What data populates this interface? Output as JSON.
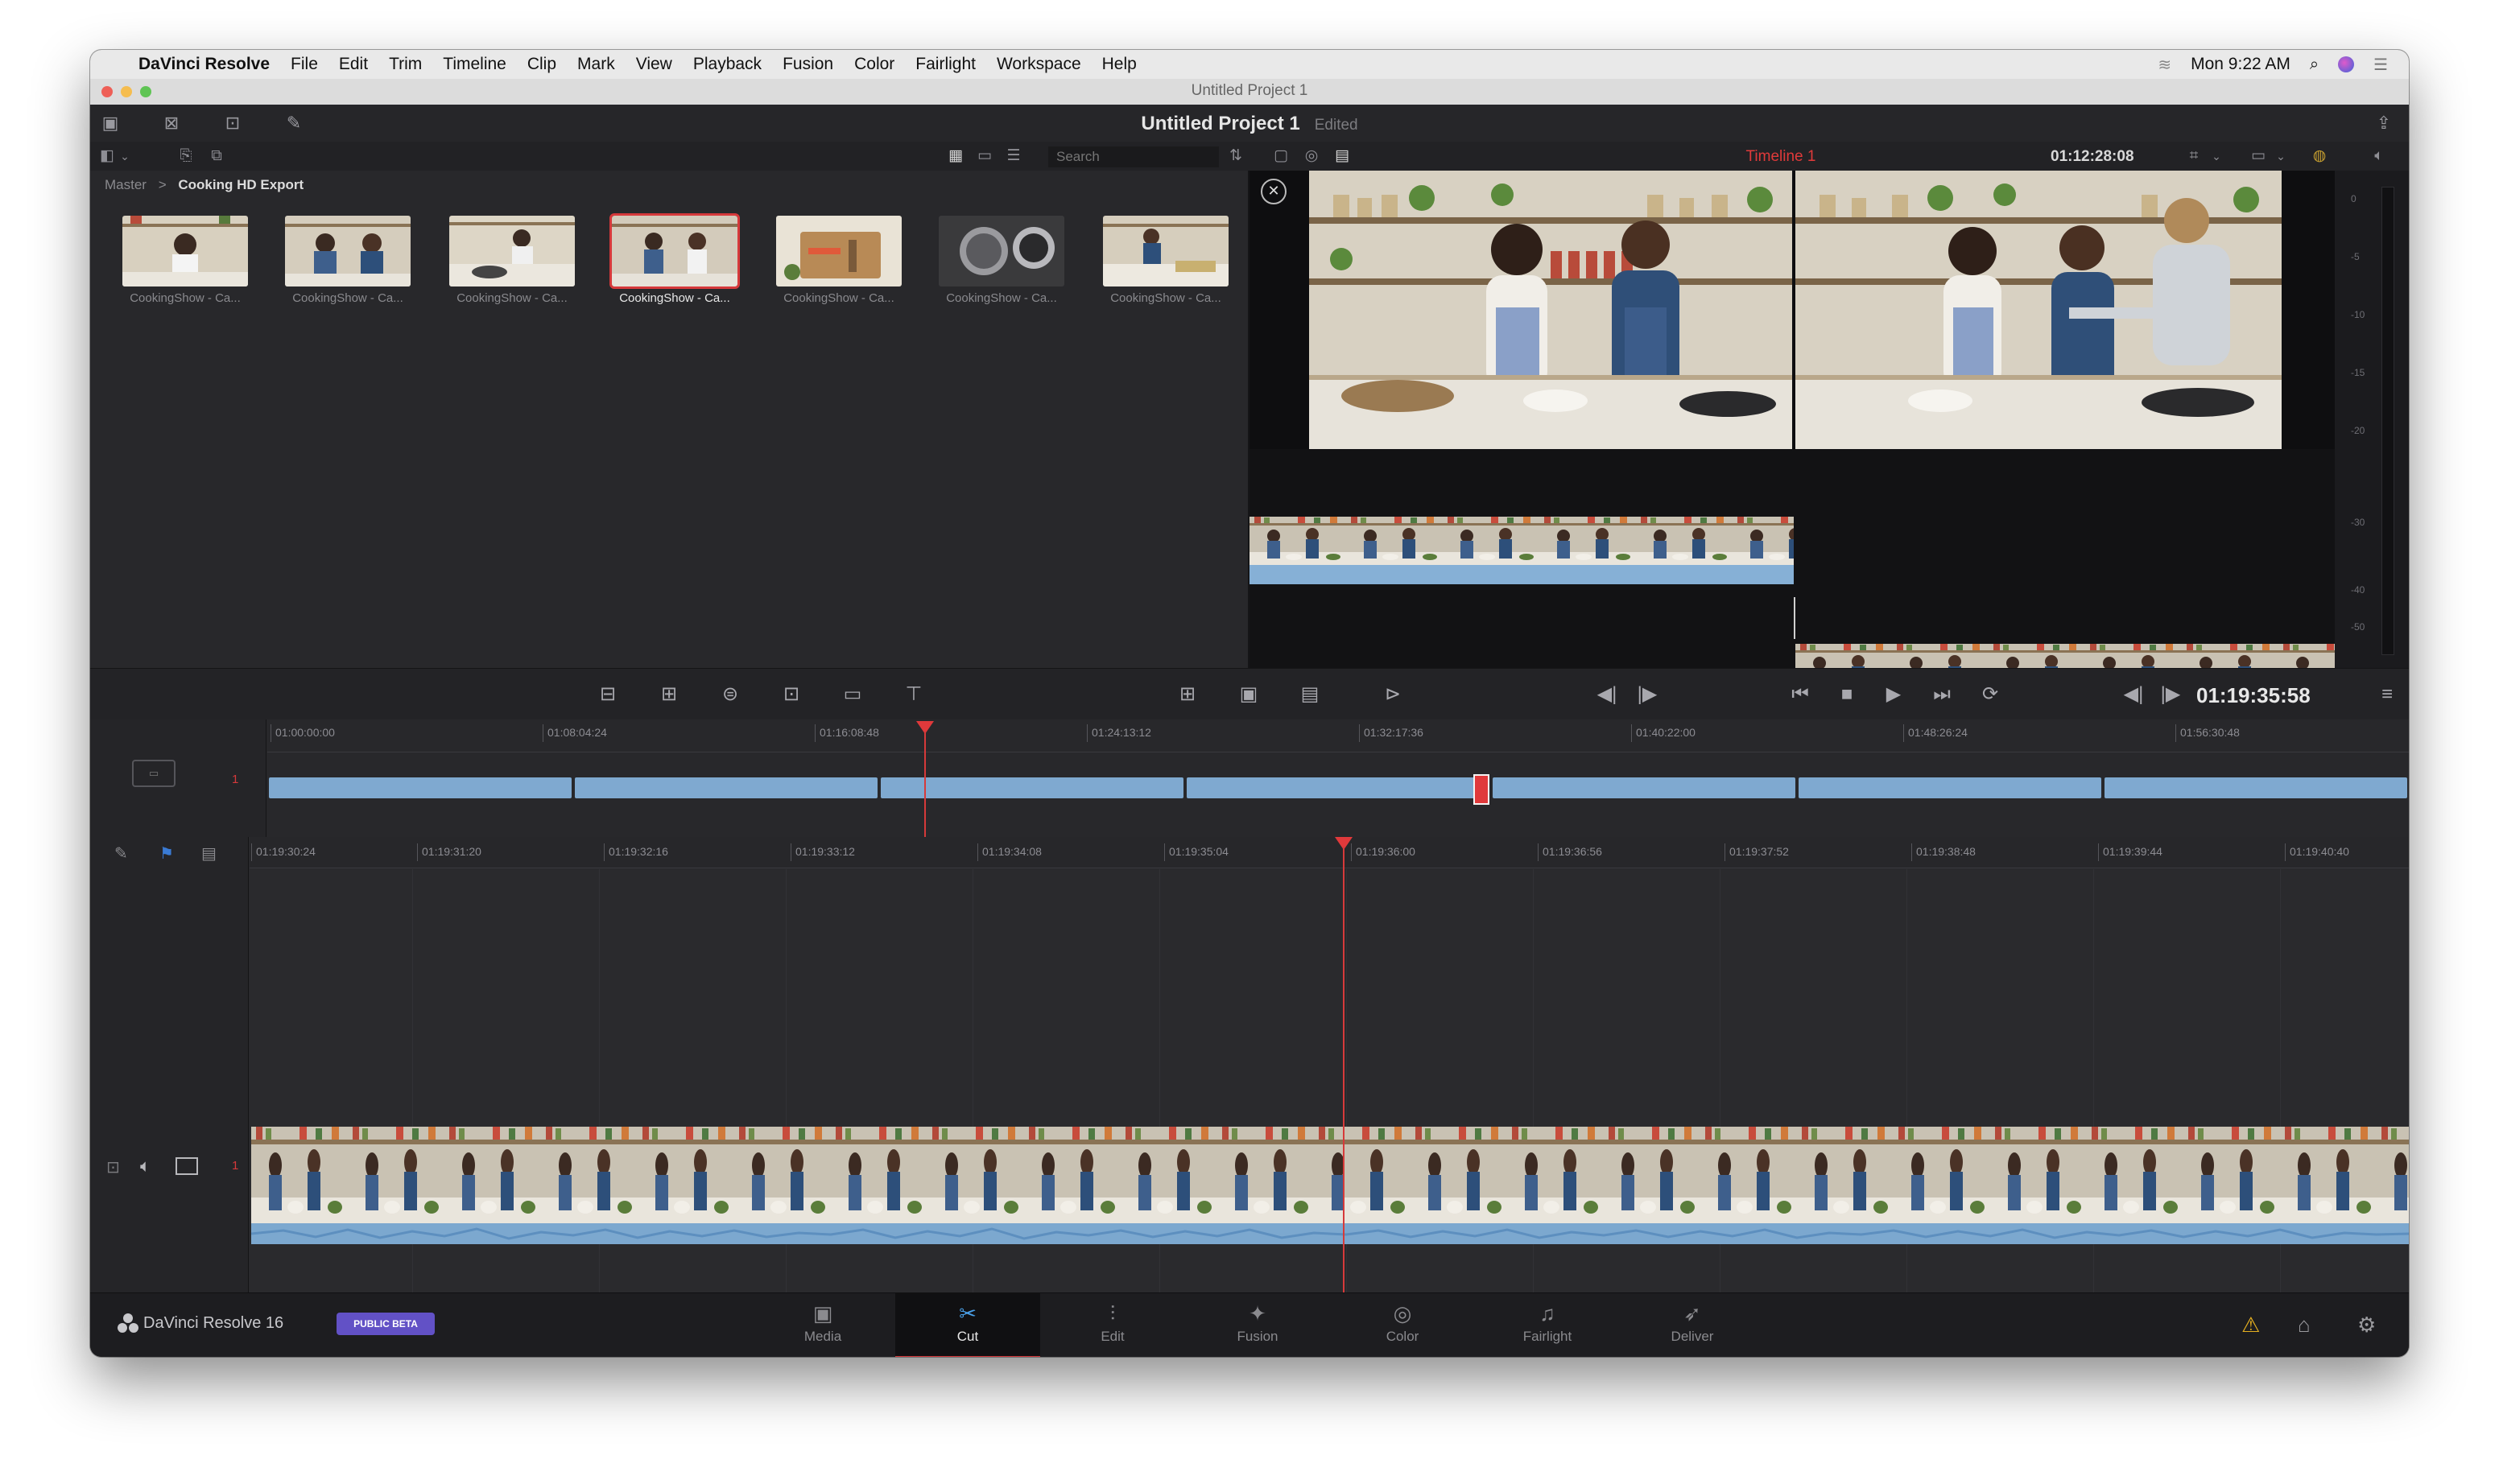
{
  "menubar": {
    "app": "DaVinci Resolve",
    "items": [
      "File",
      "Edit",
      "Trim",
      "Timeline",
      "Clip",
      "Mark",
      "View",
      "Playback",
      "Fusion",
      "Color",
      "Fairlight",
      "Workspace",
      "Help"
    ],
    "clock": "Mon 9:22 AM"
  },
  "window": {
    "title": "Untitled Project 1"
  },
  "header": {
    "project": "Untitled Project 1",
    "status": "Edited"
  },
  "toolbar": {
    "search_placeholder": "Search",
    "timeline_name": "Timeline 1",
    "timecode": "01:12:28:08"
  },
  "media_pool": {
    "breadcrumb": {
      "root": "Master",
      "current": "Cooking HD Export"
    },
    "clips": [
      {
        "label": "CookingShow - Ca..."
      },
      {
        "label": "CookingShow - Ca..."
      },
      {
        "label": "CookingShow - Ca..."
      },
      {
        "label": "CookingShow - Ca..."
      },
      {
        "label": "CookingShow - Ca..."
      },
      {
        "label": "CookingShow - Ca..."
      },
      {
        "label": "CookingShow - Ca..."
      }
    ],
    "selected_index": 3
  },
  "viewer": {
    "audio_meter_labels": [
      "0",
      "-5",
      "-10",
      "-15",
      "-20",
      "-30",
      "-40",
      "-50"
    ]
  },
  "transport": {
    "timecode": "01:19:35:58"
  },
  "upper_timeline": {
    "track_number": "1",
    "ruler": [
      "01:00:00:00",
      "01:08:04:24",
      "01:16:08:48",
      "01:24:13:12",
      "01:32:17:36",
      "01:40:22:00",
      "01:48:26:24",
      "01:56:30:48"
    ]
  },
  "lower_timeline": {
    "track_number": "1",
    "ruler": [
      "01:19:30:24",
      "01:19:31:20",
      "01:19:32:16",
      "01:19:33:12",
      "01:19:34:08",
      "01:19:35:04",
      "01:19:36:00",
      "01:19:36:56",
      "01:19:37:52",
      "01:19:38:48",
      "01:19:39:44",
      "01:19:40:40"
    ]
  },
  "page_bar": {
    "brand": "DaVinci Resolve 16",
    "badge": "PUBLIC BETA",
    "pages": [
      "Media",
      "Cut",
      "Edit",
      "Fusion",
      "Color",
      "Fairlight",
      "Deliver"
    ],
    "active": "Cut"
  },
  "colors": {
    "accent_red": "#d6393b",
    "clip_blue": "#86b0d6",
    "beta_purple": "#6251c6"
  }
}
